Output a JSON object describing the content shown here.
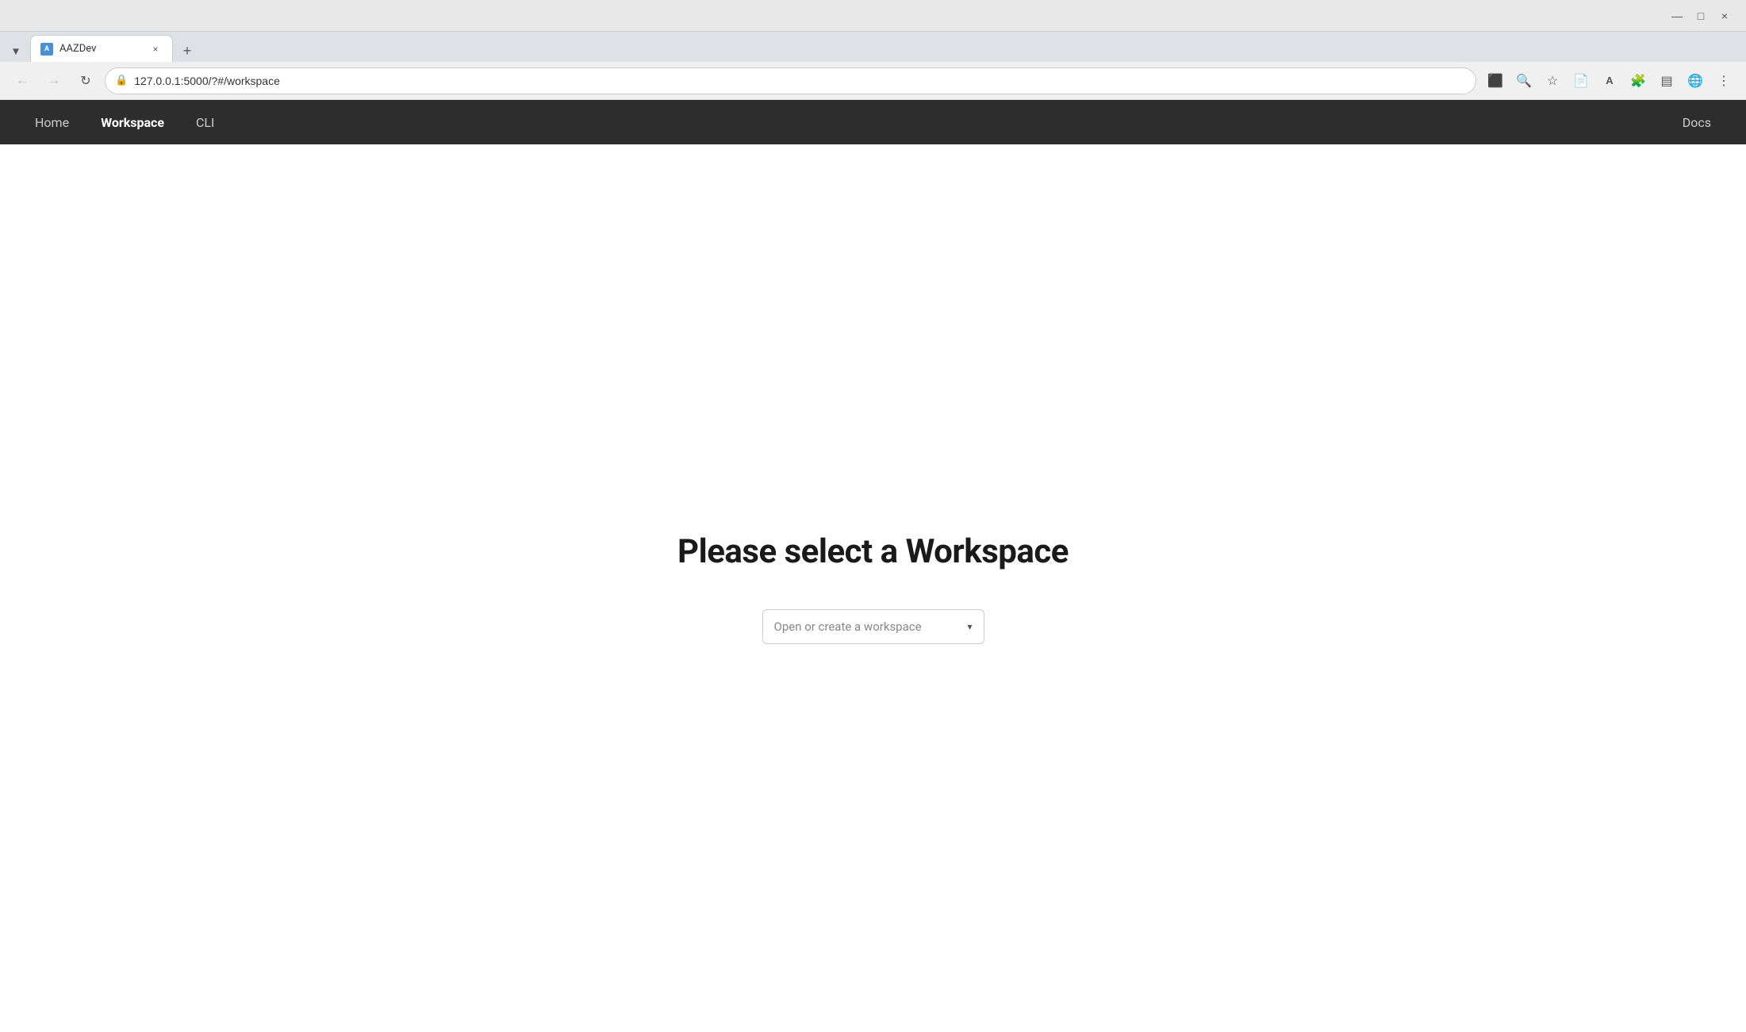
{
  "browser": {
    "tab": {
      "favicon_text": "A",
      "title": "AAZDev",
      "close_label": "×"
    },
    "new_tab_label": "+",
    "address": {
      "url": "127.0.0.1:5000/?#/workspace",
      "lock_icon": "🔒"
    },
    "toolbar": {
      "back_icon": "←",
      "forward_icon": "→",
      "reload_icon": "↻",
      "screenshot_icon": "⬛",
      "zoom_icon": "🔍",
      "bookmark_icon": "☆",
      "reader_icon": "📄",
      "translate_icon": "A",
      "extensions_icon": "🧩",
      "sidebar_icon": "▤",
      "profile_icon": "🌐",
      "menu_icon": "⋮",
      "scroll_tabs_icon": "▼"
    },
    "window_controls": {
      "minimize_icon": "—",
      "maximize_icon": "□",
      "close_icon": "×"
    }
  },
  "app": {
    "nav": {
      "items": [
        {
          "label": "Home",
          "active": false
        },
        {
          "label": "Workspace",
          "active": true
        },
        {
          "label": "CLI",
          "active": false
        }
      ],
      "docs_label": "Docs"
    },
    "main": {
      "heading": "Please select a Workspace",
      "dropdown": {
        "placeholder": "Open or create a workspace",
        "arrow": "▾"
      }
    }
  }
}
